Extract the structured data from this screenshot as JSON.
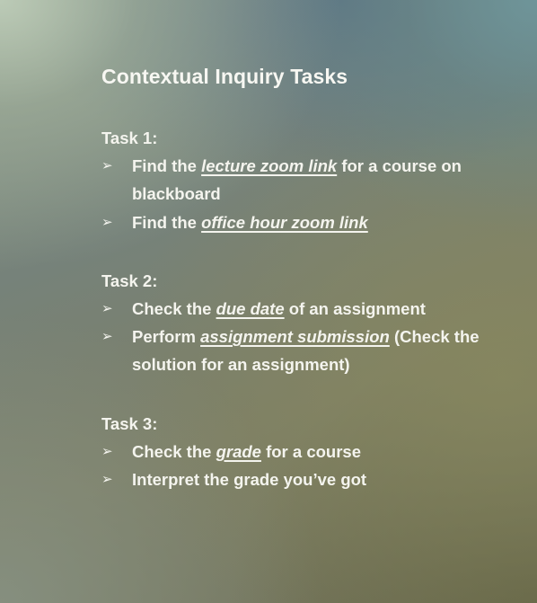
{
  "slide": {
    "title": "Contextual Inquiry Tasks",
    "bullet_glyph": "➢",
    "tasks": [
      {
        "heading": "Task 1:",
        "items": [
          {
            "pre": "Find the ",
            "em": "lecture zoom link",
            "post": " for a course on blackboard"
          },
          {
            "pre": "Find the ",
            "em": "office hour zoom link",
            "post": ""
          }
        ]
      },
      {
        "heading": "Task 2:",
        "items": [
          {
            "pre": "Check the ",
            "em": "due date",
            "post": " of an assignment"
          },
          {
            "pre": "Perform ",
            "em": "assignment submission",
            "post": " (Check the solution for an assignment)"
          }
        ]
      },
      {
        "heading": "Task 3:",
        "items": [
          {
            "pre": "Check the ",
            "em": "grade",
            "post": " for a course"
          },
          {
            "pre": "Interpret the grade you’ve got",
            "em": "",
            "post": ""
          }
        ]
      }
    ]
  }
}
